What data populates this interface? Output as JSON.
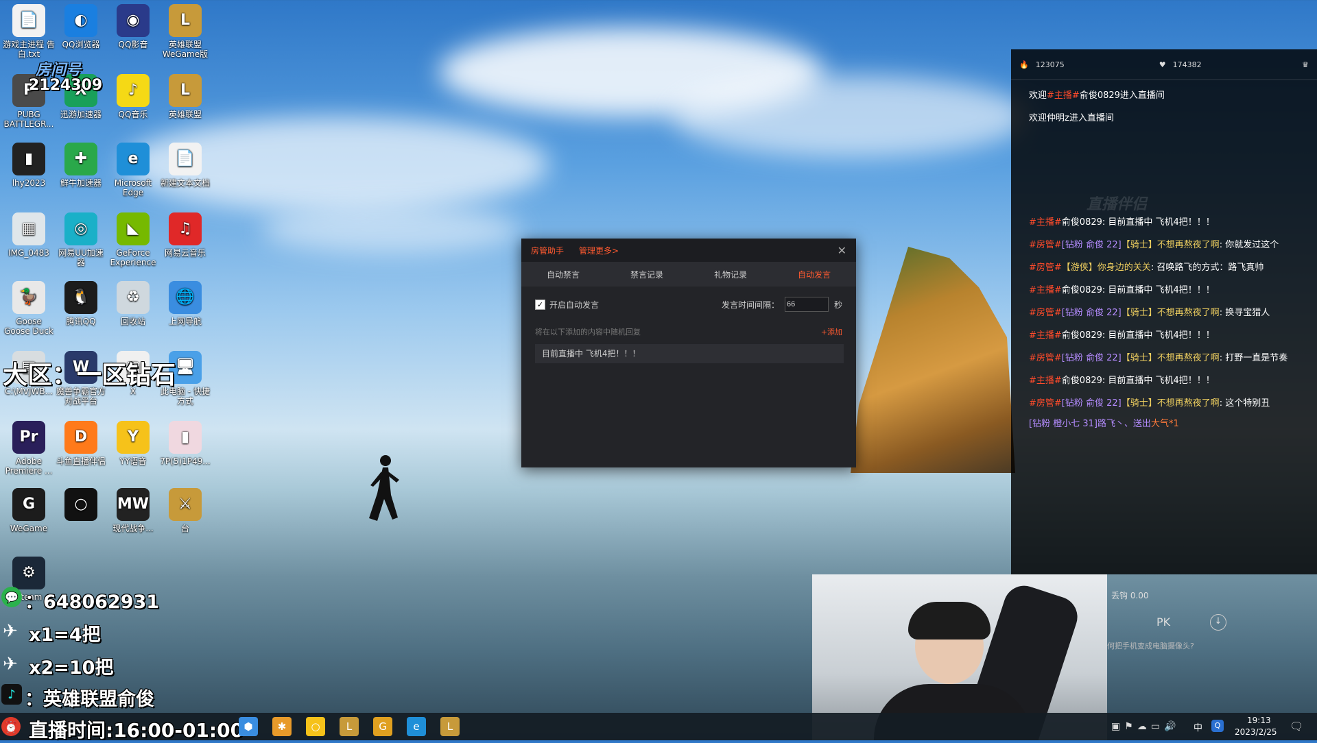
{
  "desktop_icons": [
    {
      "label": "游戏主进程 告白.txt",
      "glyph": "📄",
      "color": "#f2f2f2"
    },
    {
      "label": "QQ浏览器",
      "glyph": "◐",
      "color": "#1a7fe0"
    },
    {
      "label": "QQ影音",
      "glyph": "◉",
      "color": "#2a3a8a"
    },
    {
      "label": "英雄联盟 WeGame版",
      "glyph": "L",
      "color": "#c79a3a"
    },
    {
      "label": "PUBG BATTLEGR...",
      "glyph": "P",
      "color": "#4a4a4a"
    },
    {
      "label": "迅游加速器",
      "glyph": "X",
      "color": "#19a05a"
    },
    {
      "label": "QQ音乐",
      "glyph": "♪",
      "color": "#f5d915"
    },
    {
      "label": "英雄联盟",
      "glyph": "L",
      "color": "#c79a3a"
    },
    {
      "label": "lhy2023",
      "glyph": "▮",
      "color": "#222"
    },
    {
      "label": "鲜牛加速器",
      "glyph": "✚",
      "color": "#2aa84a"
    },
    {
      "label": "Microsoft Edge",
      "glyph": "e",
      "color": "#1f8fd8"
    },
    {
      "label": "新建文本文档",
      "glyph": "📄",
      "color": "#f2f2f2"
    },
    {
      "label": "IMG_0483",
      "glyph": "▦",
      "color": "#dfe6ea"
    },
    {
      "label": "网易UU加速器",
      "glyph": "◎",
      "color": "#1ab0c8"
    },
    {
      "label": "GeForce Experience",
      "glyph": "◣",
      "color": "#76b900"
    },
    {
      "label": "网易云音乐",
      "glyph": "♫",
      "color": "#e02828"
    },
    {
      "label": "Goose Goose Duck",
      "glyph": "🦆",
      "color": "#e8e8e8"
    },
    {
      "label": "腾讯QQ",
      "glyph": "🐧",
      "color": "#1c1c1c"
    },
    {
      "label": "回收站",
      "glyph": "♻",
      "color": "#cfd8de"
    },
    {
      "label": "上网导航",
      "glyph": "🌐",
      "color": "#3a8de0"
    },
    {
      "label": "C:\\MVJWB...",
      "glyph": "▤",
      "color": "#d8dde0"
    },
    {
      "label": "魔兽争霸官方对战平台",
      "glyph": "W",
      "color": "#2a3a6a"
    },
    {
      "label": "X",
      "glyph": "▢",
      "color": "#f0f0f0"
    },
    {
      "label": "此电脑 - 快捷方式",
      "glyph": "🖥",
      "color": "#4aa0e8"
    },
    {
      "label": "Adobe Premiere ...",
      "glyph": "Pr",
      "color": "#2a1f5a"
    },
    {
      "label": "斗鱼直播伴侣",
      "glyph": "D",
      "color": "#ff7a1a"
    },
    {
      "label": "YY语音",
      "glyph": "Y",
      "color": "#f6c21a"
    },
    {
      "label": "7P(5)1P49...",
      "glyph": "▮",
      "color": "#f0d8e0"
    },
    {
      "label": "WeGame",
      "glyph": "G",
      "color": "#1c1c1c"
    },
    {
      "label": "",
      "glyph": "○",
      "color": "#111"
    },
    {
      "label": "现代战争...",
      "glyph": "MW",
      "color": "#222"
    },
    {
      "label": "台",
      "glyph": "⚔",
      "color": "#c79a3a"
    },
    {
      "label": "Steam",
      "glyph": "⚙",
      "color": "#1b2838"
    }
  ],
  "overlays": {
    "room_label": "房间号",
    "room_number": "2124309",
    "region": "大区：一区钻石",
    "wechat": "：648062931",
    "rule1": "x1=4把",
    "rule2": "x2=10把",
    "douyin": "：英雄联盟俞俊",
    "stream_time": "直播时间:16:00-01:00"
  },
  "chat_panel": {
    "heat": "123075",
    "likes": "174382",
    "welcome_lines": [
      {
        "pre": "欢迎",
        "tag": "#主播#",
        "rest": "俞俊0829进入直播间"
      },
      {
        "pre": "欢迎仲明z进入直播间",
        "tag": "",
        "rest": ""
      }
    ],
    "watermark": "直播伴侣",
    "messages": [
      {
        "tag": "#主播#",
        "badge": "",
        "user": "俞俊0829",
        "text": "目前直播中 飞机4把！！！"
      },
      {
        "tag": "#房管#",
        "badge": "[钻粉 俞俊 22]",
        "user": "【骑士】不想再熬夜了啊",
        "text": "你就发过这个"
      },
      {
        "tag": "#房管#",
        "badge": "",
        "user": "【游侠】你身边的关关",
        "text": "召唤路飞的方式：路飞真帅"
      },
      {
        "tag": "#主播#",
        "badge": "",
        "user": "俞俊0829",
        "text": "目前直播中 飞机4把！！！"
      },
      {
        "tag": "#房管#",
        "badge": "[钻粉 俞俊 22]",
        "user": "【骑士】不想再熬夜了啊",
        "text": "换寻宝猎人"
      },
      {
        "tag": "#主播#",
        "badge": "",
        "user": "俞俊0829",
        "text": "目前直播中 飞机4把！！！"
      },
      {
        "tag": "#房管#",
        "badge": "[钻粉 俞俊 22]",
        "user": "【骑士】不想再熬夜了啊",
        "text": "打野一直是节奏"
      },
      {
        "tag": "#主播#",
        "badge": "",
        "user": "俞俊0829",
        "text": "目前直播中 飞机4把！！！"
      },
      {
        "tag": "#房管#",
        "badge": "[钻粉 俞俊 22]",
        "user": "【骑士】不想再熬夜了啊",
        "text": "这个特别丑"
      }
    ],
    "gift_line": {
      "badge": "[钻粉 橙小七 31]",
      "user": "路飞丶、",
      "action": "送出",
      "gift": "大气*1"
    },
    "balance": "丢钩 0.00",
    "footer_hint": "何把手机变成电脑摄像头?"
  },
  "dialog": {
    "title": "房管助手",
    "more_link": "管理更多>",
    "tabs": [
      "自动禁言",
      "禁言记录",
      "礼物记录",
      "自动发言"
    ],
    "active_tab": 3,
    "auto_speak_label": "开启自动发言",
    "auto_speak_checked": true,
    "interval_label": "发言时间间隔：",
    "interval_value": "66",
    "interval_unit": "秒",
    "hint": "将在以下添加的内容中随机回复",
    "add_link": "+添加",
    "entry": "目前直播中 飞机4把！！！"
  },
  "taskbar": {
    "apps": [
      {
        "glyph": "⬢",
        "color": "#3a8de0"
      },
      {
        "glyph": "✱",
        "color": "#e89a2a"
      },
      {
        "glyph": "○",
        "color": "#f6c21a"
      },
      {
        "glyph": "L",
        "color": "#c79a3a"
      },
      {
        "glyph": "G",
        "color": "#e0a020"
      },
      {
        "glyph": "e",
        "color": "#1f8fd8"
      },
      {
        "glyph": "L",
        "color": "#c79a3a"
      }
    ],
    "ime": "中",
    "time": "19:13",
    "date": "2023/2/25"
  },
  "colors": {
    "accent_red": "#ff4b2b",
    "mgr_orange": "#ff5a30",
    "purple": "#b58cff",
    "dialog_bg": "#232428"
  }
}
